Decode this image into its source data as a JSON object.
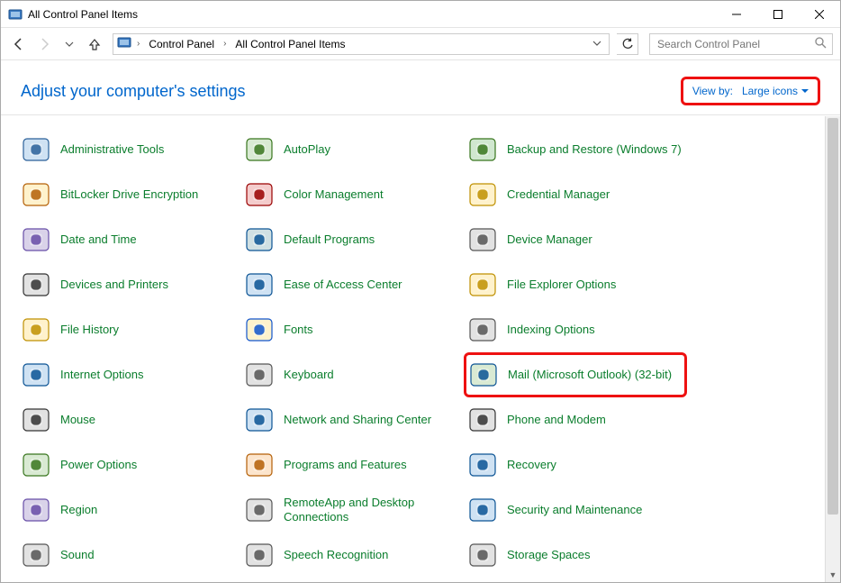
{
  "titlebar": {
    "title": "All Control Panel Items"
  },
  "breadcrumb": {
    "items": [
      "Control Panel",
      "All Control Panel Items"
    ]
  },
  "search": {
    "placeholder": "Search Control Panel"
  },
  "header": {
    "heading": "Adjust your computer's settings",
    "viewby_label": "View by:",
    "viewby_value": "Large icons"
  },
  "items": [
    {
      "label": "Administrative Tools",
      "icon": "admin-tools-icon"
    },
    {
      "label": "AutoPlay",
      "icon": "autoplay-icon"
    },
    {
      "label": "Backup and Restore (Windows 7)",
      "icon": "backup-restore-icon"
    },
    {
      "label": "BitLocker Drive Encryption",
      "icon": "bitlocker-icon"
    },
    {
      "label": "Color Management",
      "icon": "color-mgmt-icon"
    },
    {
      "label": "Credential Manager",
      "icon": "credential-mgr-icon"
    },
    {
      "label": "Date and Time",
      "icon": "date-time-icon"
    },
    {
      "label": "Default Programs",
      "icon": "default-programs-icon"
    },
    {
      "label": "Device Manager",
      "icon": "device-mgr-icon"
    },
    {
      "label": "Devices and Printers",
      "icon": "devices-printers-icon"
    },
    {
      "label": "Ease of Access Center",
      "icon": "ease-access-icon"
    },
    {
      "label": "File Explorer Options",
      "icon": "file-explorer-opts-icon"
    },
    {
      "label": "File History",
      "icon": "file-history-icon"
    },
    {
      "label": "Fonts",
      "icon": "fonts-icon"
    },
    {
      "label": "Indexing Options",
      "icon": "indexing-icon"
    },
    {
      "label": "Internet Options",
      "icon": "internet-opts-icon"
    },
    {
      "label": "Keyboard",
      "icon": "keyboard-icon"
    },
    {
      "label": "Mail (Microsoft Outlook) (32-bit)",
      "icon": "mail-icon",
      "highlight": true
    },
    {
      "label": "Mouse",
      "icon": "mouse-icon"
    },
    {
      "label": "Network and Sharing Center",
      "icon": "network-sharing-icon"
    },
    {
      "label": "Phone and Modem",
      "icon": "phone-modem-icon"
    },
    {
      "label": "Power Options",
      "icon": "power-opts-icon"
    },
    {
      "label": "Programs and Features",
      "icon": "programs-features-icon"
    },
    {
      "label": "Recovery",
      "icon": "recovery-icon"
    },
    {
      "label": "Region",
      "icon": "region-icon"
    },
    {
      "label": "RemoteApp and Desktop Connections",
      "icon": "remoteapp-icon"
    },
    {
      "label": "Security and Maintenance",
      "icon": "security-maint-icon"
    },
    {
      "label": "Sound",
      "icon": "sound-icon"
    },
    {
      "label": "Speech Recognition",
      "icon": "speech-icon"
    },
    {
      "label": "Storage Spaces",
      "icon": "storage-spaces-icon"
    }
  ],
  "icon_colors": {
    "admin-tools-icon": {
      "bg": "#cfe2f3",
      "fg": "#2a6099"
    },
    "autoplay-icon": {
      "bg": "#d9ead3",
      "fg": "#38761d"
    },
    "backup-restore-icon": {
      "bg": "#d0e7cf",
      "fg": "#38761d"
    },
    "bitlocker-icon": {
      "bg": "#fff2cc",
      "fg": "#b45f06"
    },
    "color-mgmt-icon": {
      "bg": "#f4cccc",
      "fg": "#990000"
    },
    "credential-mgr-icon": {
      "bg": "#fff2cc",
      "fg": "#bf9000"
    },
    "date-time-icon": {
      "bg": "#d9d2e9",
      "fg": "#674ea7"
    },
    "default-programs-icon": {
      "bg": "#d0e0e3",
      "fg": "#0b5394"
    },
    "device-mgr-icon": {
      "bg": "#e2e2e2",
      "fg": "#555"
    },
    "devices-printers-icon": {
      "bg": "#e2e2e2",
      "fg": "#333"
    },
    "ease-access-icon": {
      "bg": "#cfe2f3",
      "fg": "#0b5394"
    },
    "file-explorer-opts-icon": {
      "bg": "#fff2cc",
      "fg": "#bf9000"
    },
    "file-history-icon": {
      "bg": "#fff2cc",
      "fg": "#bf9000"
    },
    "fonts-icon": {
      "bg": "#fff2cc",
      "fg": "#1155cc"
    },
    "indexing-icon": {
      "bg": "#e2e2e2",
      "fg": "#555"
    },
    "internet-opts-icon": {
      "bg": "#cfe2f3",
      "fg": "#0b5394"
    },
    "keyboard-icon": {
      "bg": "#e2e2e2",
      "fg": "#555"
    },
    "mail-icon": {
      "bg": "#d9ead3",
      "fg": "#0b5394"
    },
    "mouse-icon": {
      "bg": "#e2e2e2",
      "fg": "#333"
    },
    "network-sharing-icon": {
      "bg": "#cfe2f3",
      "fg": "#0b5394"
    },
    "phone-modem-icon": {
      "bg": "#e2e2e2",
      "fg": "#333"
    },
    "power-opts-icon": {
      "bg": "#d9ead3",
      "fg": "#38761d"
    },
    "programs-features-icon": {
      "bg": "#fce5cd",
      "fg": "#b45f06"
    },
    "recovery-icon": {
      "bg": "#cfe2f3",
      "fg": "#0b5394"
    },
    "region-icon": {
      "bg": "#d9d2e9",
      "fg": "#674ea7"
    },
    "remoteapp-icon": {
      "bg": "#e2e2e2",
      "fg": "#555"
    },
    "security-maint-icon": {
      "bg": "#cfe2f3",
      "fg": "#0b5394"
    },
    "sound-icon": {
      "bg": "#e2e2e2",
      "fg": "#555"
    },
    "speech-icon": {
      "bg": "#e2e2e2",
      "fg": "#555"
    },
    "storage-spaces-icon": {
      "bg": "#e2e2e2",
      "fg": "#555"
    }
  }
}
